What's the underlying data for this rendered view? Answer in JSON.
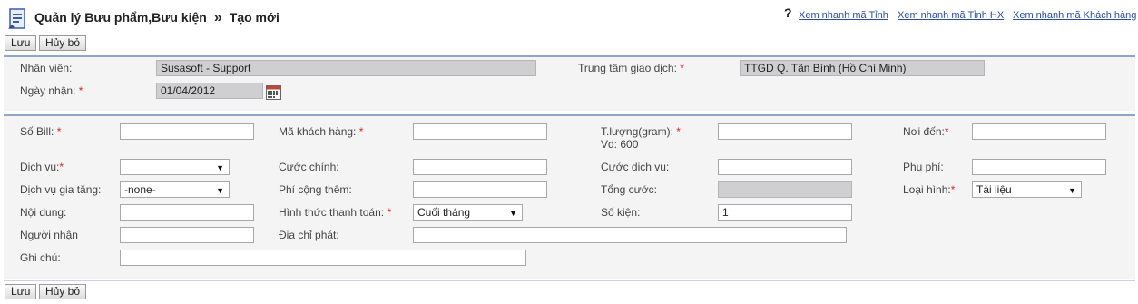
{
  "header": {
    "title": "Quản lý Bưu phẩm,Bưu kiện",
    "separator": "»",
    "subtitle": "Tạo mới",
    "help_icon": "?",
    "links": [
      "Xem nhanh mã Tỉnh",
      "Xem nhanh mã Tỉnh HX",
      "Xem nhanh mã Khách hàng"
    ]
  },
  "toolbar": {
    "save_label": "Lưu",
    "cancel_label": "Hủy bỏ"
  },
  "section1": {
    "employee_label": "Nhân viên:",
    "employee_value": "Susasoft - Support",
    "center_label": "Trung tâm giao dịch:",
    "center_value": "TTGD Q. Tân Bình (Hồ Chí Minh)",
    "date_label": "Ngày nhận:",
    "date_value": "01/04/2012"
  },
  "section2": {
    "bill_label": "Số Bill:",
    "customer_label": "Mã khách hàng:",
    "weight_label": "T.lượng(gram):",
    "weight_hint": "Vd: 600",
    "destination_label": "Nơi đến:",
    "service_label": "Dịch vụ:",
    "main_fee_label": "Cước chính:",
    "service_fee_label": "Cước dịch vụ:",
    "surcharge_label": "Phụ phí:",
    "addon_label": "Dịch vụ gia tăng:",
    "addon_value": "-none-",
    "extra_fee_label": "Phí cộng thêm:",
    "total_label": "Tổng cước:",
    "type_label": "Loại hình:",
    "type_value": "Tài liệu",
    "content_label": "Nội dung:",
    "payment_label": "Hình thức thanh toán:",
    "payment_value": "Cuối tháng",
    "pieces_label": "Số kiện:",
    "pieces_value": "1",
    "recipient_label": "Người nhận",
    "address_label": "Địa chỉ phát:",
    "note_label": "Ghi chú:"
  },
  "required_marker": "*",
  "icons": {
    "app": "document-edit-icon",
    "calendar": "calendar-icon",
    "dropdown": "chevron-down-icon"
  }
}
